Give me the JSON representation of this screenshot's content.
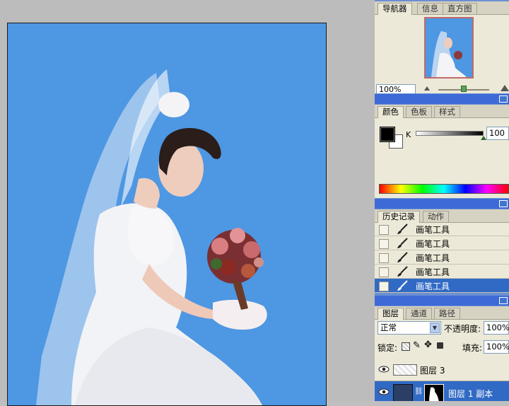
{
  "navigator": {
    "tabs": [
      "导航器",
      "信息",
      "直方图"
    ],
    "zoom": "100%",
    "slider_fraction": 0.5
  },
  "color": {
    "tabs": [
      "颜色",
      "色板",
      "样式"
    ],
    "channel_label": "K",
    "value": "100",
    "fg_color": "#000000",
    "bg_color": "#ffffff"
  },
  "history": {
    "tabs": [
      "历史记录",
      "动作"
    ],
    "items": [
      "画笔工具",
      "画笔工具",
      "画笔工具",
      "画笔工具",
      "画笔工具"
    ],
    "selected_index": 4
  },
  "layers": {
    "tabs": [
      "图层",
      "通道",
      "路径"
    ],
    "blend_mode": "正常",
    "opacity_label": "不透明度:",
    "opacity": "100%",
    "lock_label": "锁定:",
    "fill_label": "填充:",
    "fill": "100%",
    "items": [
      {
        "name": "图层 3"
      },
      {
        "name": "图层 1 副本"
      }
    ]
  },
  "colors": {
    "canvas_bg": "#4e97e2",
    "panel_bg": "#ece9d8",
    "selection": "#316ac5",
    "title_bar": "#3d6ad6"
  }
}
